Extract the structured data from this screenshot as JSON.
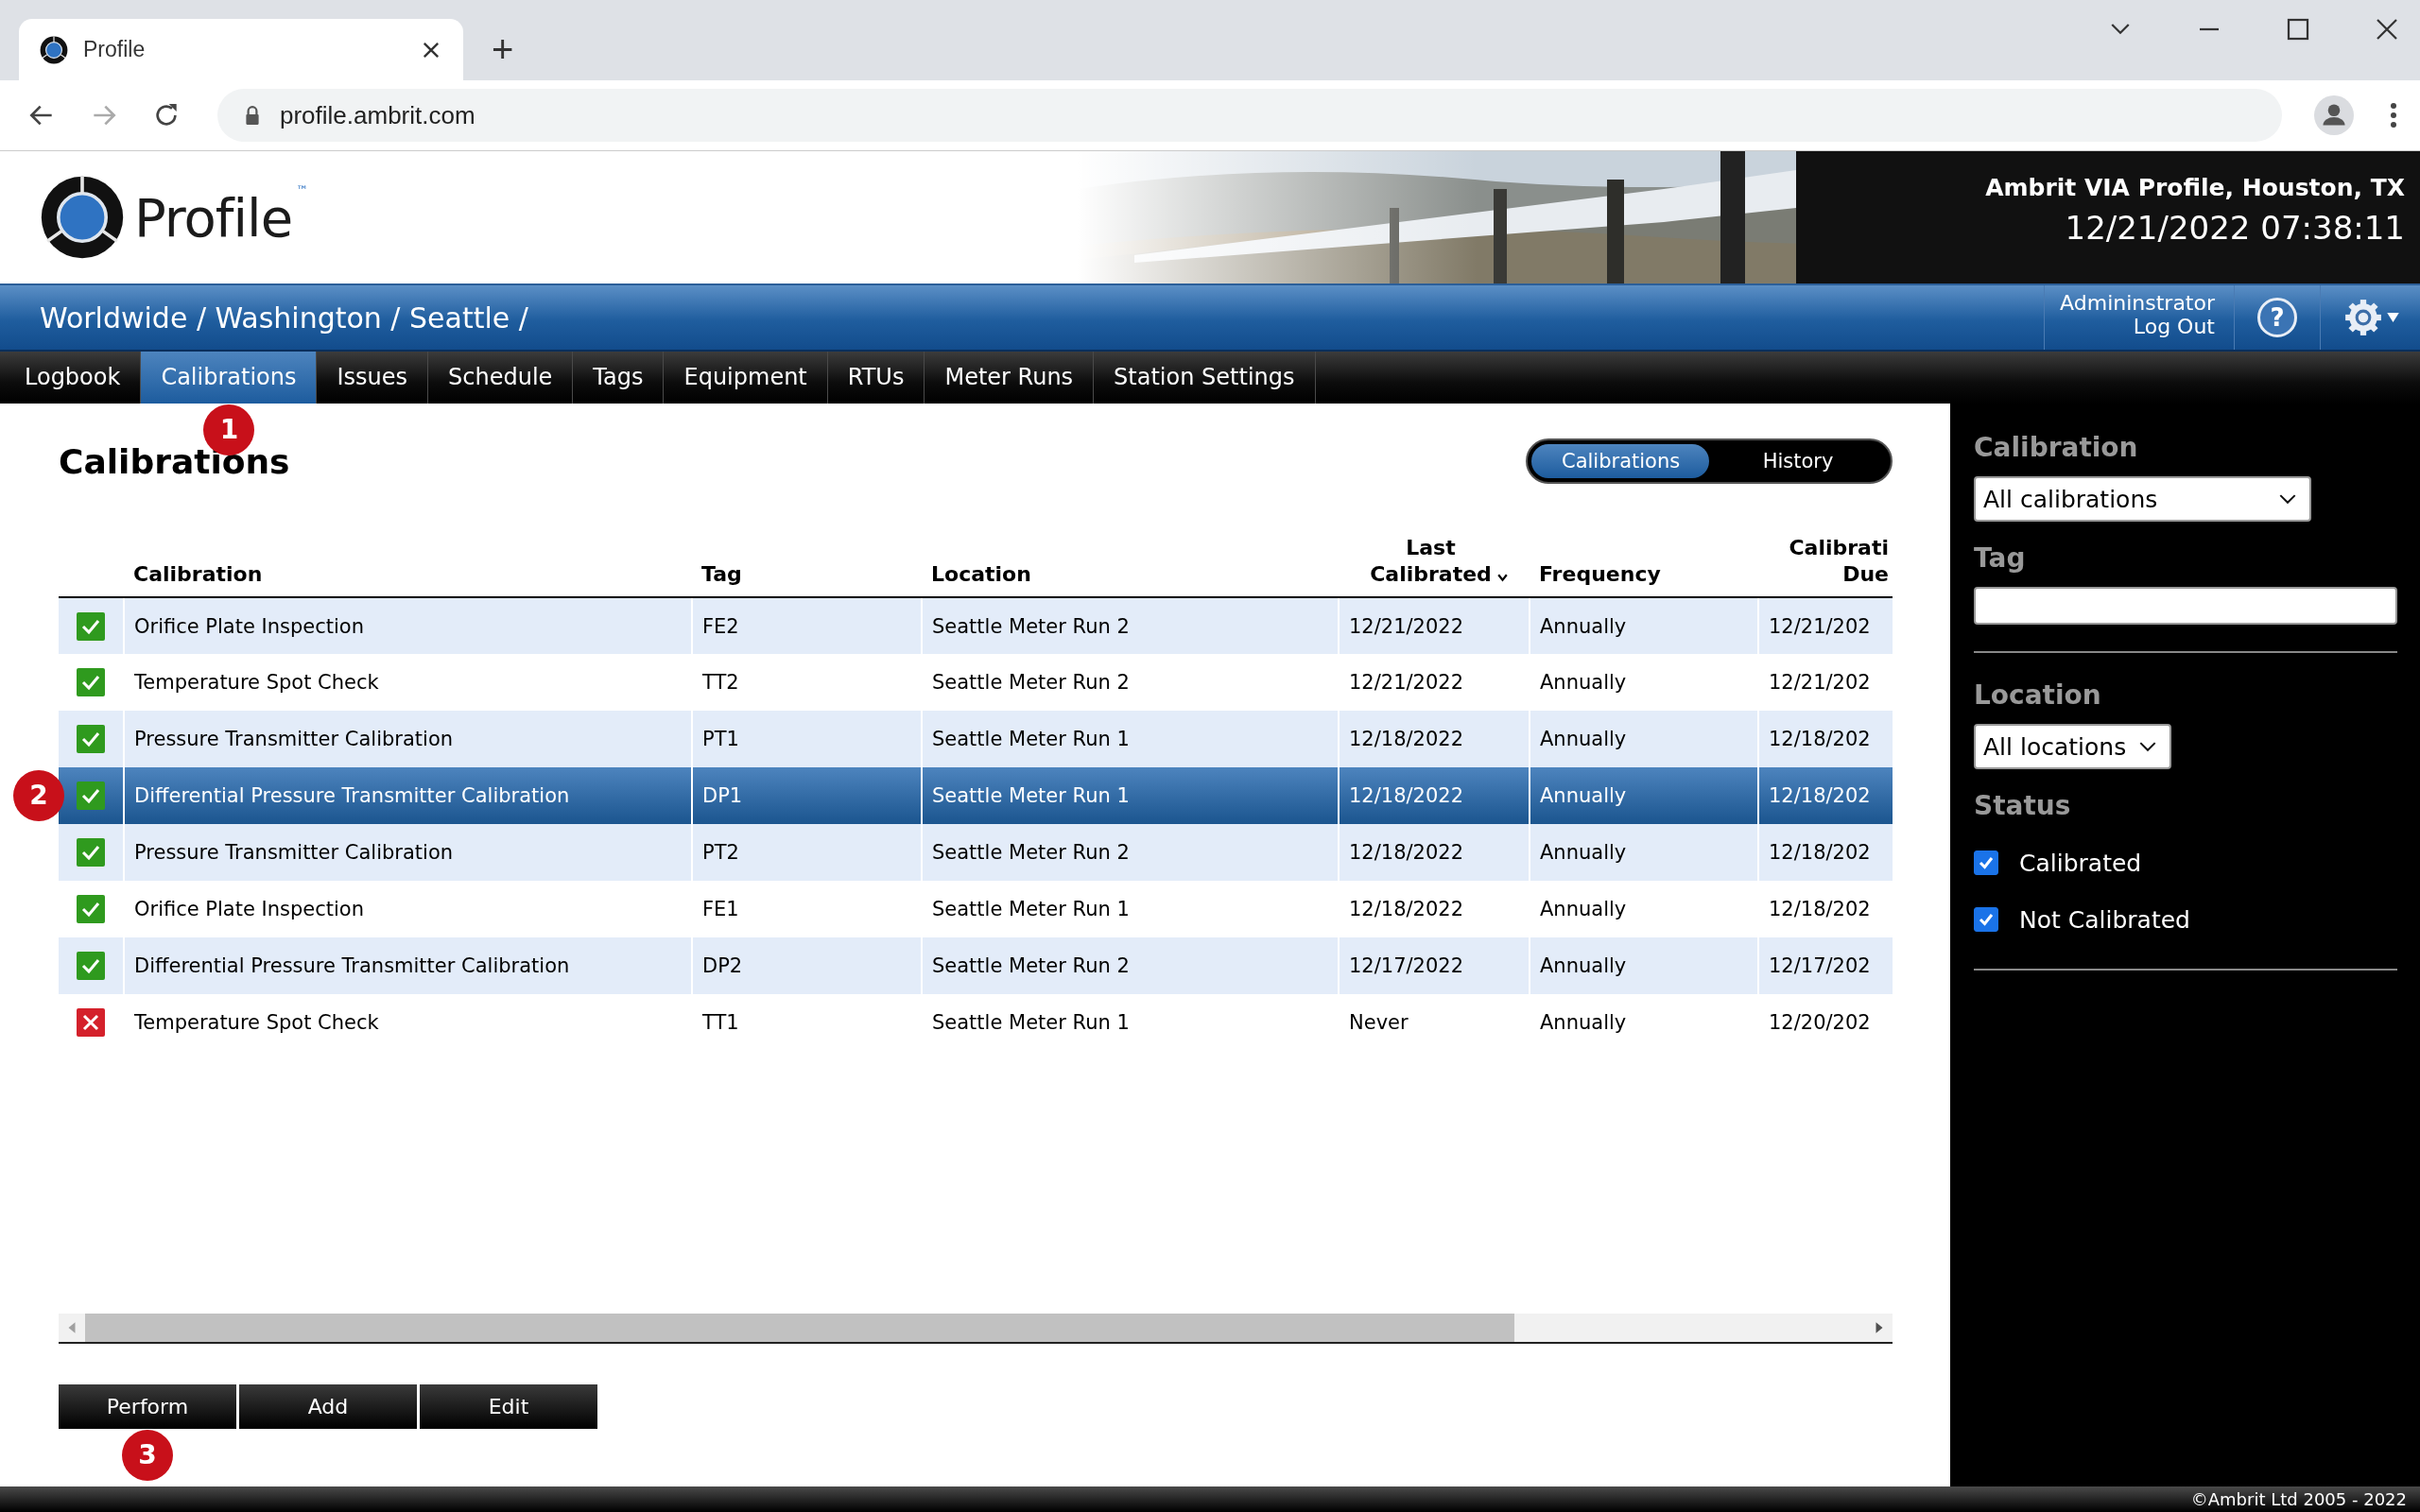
{
  "browser": {
    "tabs": [
      {
        "title": "Profile",
        "selected": true
      }
    ],
    "new_tab": "+",
    "url": "profile.ambrit.com"
  },
  "header": {
    "logo_text": "Profile",
    "trademark": "™",
    "site": "Ambrit VIA Profile, Houston, TX",
    "datetime": "12/21/2022 07:38:11"
  },
  "breadcrumb": "Worldwide / Washington / Seattle /",
  "user": {
    "name": "Admininstrator",
    "logout": "Log Out",
    "help": "?"
  },
  "nav": [
    {
      "label": "Logbook",
      "selected": false
    },
    {
      "label": "Calibrations",
      "selected": true,
      "callout": "1"
    },
    {
      "label": "Issues",
      "selected": false
    },
    {
      "label": "Schedule",
      "selected": false
    },
    {
      "label": "Tags",
      "selected": false
    },
    {
      "label": "Equipment",
      "selected": false
    },
    {
      "label": "RTUs",
      "selected": false
    },
    {
      "label": "Meter Runs",
      "selected": false
    },
    {
      "label": "Station Settings",
      "selected": false
    }
  ],
  "page": {
    "title": "Calibrations",
    "views": [
      {
        "label": "Calibrations",
        "selected": true
      },
      {
        "label": "History",
        "selected": false
      }
    ]
  },
  "table": {
    "columns": [
      {
        "label": "Calibration",
        "sorted": false
      },
      {
        "label": "Tag",
        "sorted": false
      },
      {
        "label": "Location",
        "sorted": false
      },
      {
        "label": "Last Calibrated",
        "sorted": true
      },
      {
        "label": "Frequency",
        "sorted": false
      },
      {
        "label": "Calibrati Due",
        "sorted": false
      }
    ],
    "rows": [
      {
        "calibrated": true,
        "selected": false,
        "cells": [
          "Orifice Plate Inspection",
          "FE2",
          "Seattle Meter Run 2",
          "12/21/2022",
          "Annually",
          "12/21/202"
        ]
      },
      {
        "calibrated": true,
        "selected": false,
        "cells": [
          "Temperature Spot Check",
          "TT2",
          "Seattle Meter Run 2",
          "12/21/2022",
          "Annually",
          "12/21/202"
        ]
      },
      {
        "calibrated": true,
        "selected": false,
        "cells": [
          "Pressure Transmitter Calibration",
          "PT1",
          "Seattle Meter Run 1",
          "12/18/2022",
          "Annually",
          "12/18/202"
        ]
      },
      {
        "calibrated": true,
        "selected": true,
        "callout": "2",
        "cells": [
          "Differential Pressure Transmitter Calibration",
          "DP1",
          "Seattle Meter Run 1",
          "12/18/2022",
          "Annually",
          "12/18/202"
        ]
      },
      {
        "calibrated": true,
        "selected": false,
        "cells": [
          "Pressure Transmitter Calibration",
          "PT2",
          "Seattle Meter Run 2",
          "12/18/2022",
          "Annually",
          "12/18/202"
        ]
      },
      {
        "calibrated": true,
        "selected": false,
        "cells": [
          "Orifice Plate Inspection",
          "FE1",
          "Seattle Meter Run 1",
          "12/18/2022",
          "Annually",
          "12/18/202"
        ]
      },
      {
        "calibrated": true,
        "selected": false,
        "cells": [
          "Differential Pressure Transmitter Calibration",
          "DP2",
          "Seattle Meter Run 2",
          "12/17/2022",
          "Annually",
          "12/17/202"
        ]
      },
      {
        "calibrated": false,
        "selected": false,
        "cells": [
          "Temperature Spot Check",
          "TT1",
          "Seattle Meter Run 1",
          "Never",
          "Annually",
          "12/20/202"
        ]
      }
    ]
  },
  "actions": [
    {
      "label": "Perform",
      "callout": "3"
    },
    {
      "label": "Add"
    },
    {
      "label": "Edit"
    }
  ],
  "filters": {
    "calibration": {
      "label": "Calibration",
      "value": "All calibrations"
    },
    "tag": {
      "label": "Tag"
    },
    "location": {
      "label": "Location",
      "value": "All locations"
    },
    "status": {
      "label": "Status",
      "options": [
        {
          "label": "Calibrated",
          "checked": true
        },
        {
          "label": "Not Calibrated",
          "checked": true
        }
      ]
    }
  },
  "footer": "©Ambrit Ltd 2005 - 2022"
}
